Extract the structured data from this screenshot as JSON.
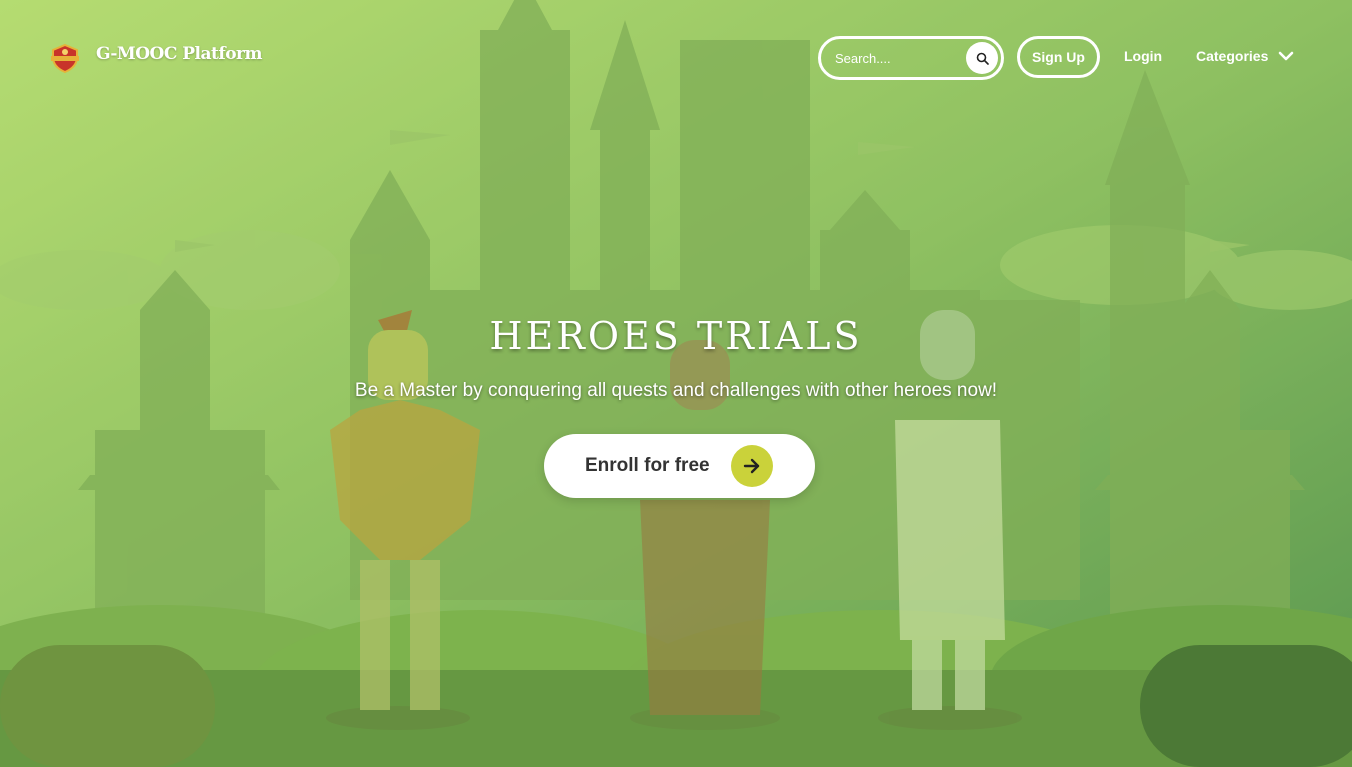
{
  "header": {
    "brand_name": "G-MOOC Platform",
    "logo_icon": "crest-shield-icon",
    "search": {
      "placeholder": "Search....",
      "value": "",
      "icon": "search-icon"
    },
    "signup_label": "Sign Up",
    "login_label": "Login",
    "categories_label": "Categories",
    "categories_icon": "chevron-down-icon"
  },
  "hero": {
    "title": "HEROES TRIALS",
    "subtitle": "Be a Master by conquering all quests and challenges with other heroes now!",
    "cta_label": "Enroll for free",
    "cta_icon": "arrow-right-icon"
  },
  "colors": {
    "accent": "#cad23a",
    "bg_light": "#b6da6e",
    "bg_dark": "#4f8e4e",
    "text_on_bg": "#ffffff"
  }
}
